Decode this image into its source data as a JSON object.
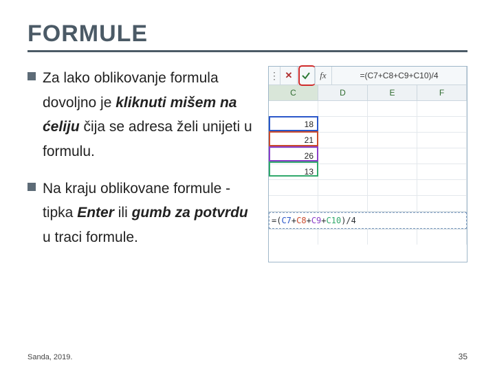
{
  "title": "FORMULE",
  "bullets": {
    "b1": {
      "pref": "Za lako oblikovanje formula dovoljno je ",
      "emph": "kliknuti mišem na ćeliju",
      "tail": " čija se adresa želi unijeti u formulu."
    },
    "b2": {
      "pref": "Na kraju oblikovane formule - tipka ",
      "emph1": "Enter",
      "mid": " ili ",
      "emph2": "gumb za potvrdu",
      "tail": " u traci formule."
    }
  },
  "footer": "Sanda, 2019.",
  "page": "35",
  "excel": {
    "formula_bar": "=(C7+C8+C9+C10)/4",
    "columns": [
      "C",
      "D",
      "E",
      "F"
    ],
    "values": [
      "",
      "18",
      "21",
      "26",
      "13"
    ],
    "edit_prefix": "=(",
    "c7": "C7",
    "c8": "C8",
    "c9": "C9",
    "c10": "C10",
    "sep": "+",
    "edit_suffix": ")/4"
  }
}
